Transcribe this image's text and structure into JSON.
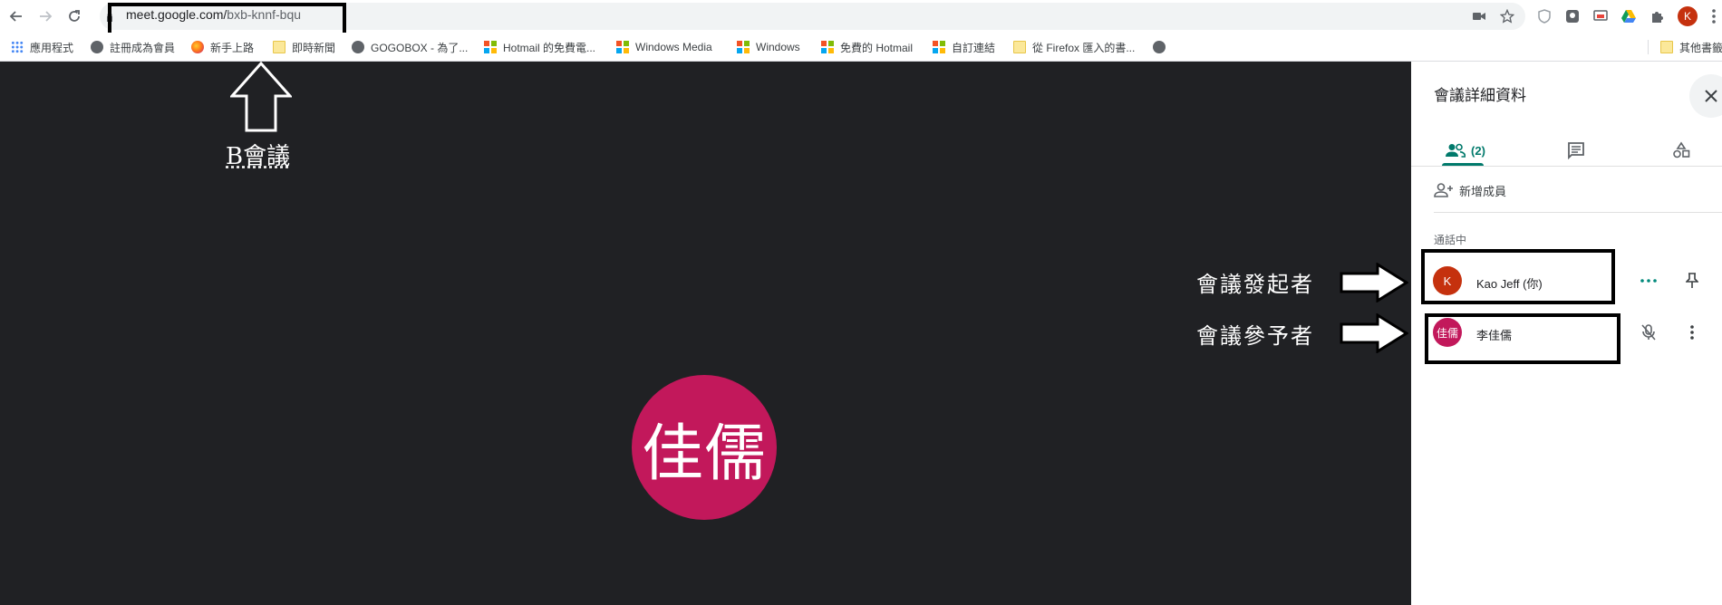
{
  "browser": {
    "url_host": "meet.google.com/",
    "url_path": "bxb-knnf-bqu",
    "profile_initial": "K",
    "icons": [
      "back-icon",
      "forward-icon",
      "reload-icon",
      "camera-icon",
      "star-icon",
      "extension-icon",
      "google-drive-icon",
      "puzzle-icon",
      "menu-icon"
    ]
  },
  "bookmarks": [
    {
      "label": "應用程式",
      "icon": "apps"
    },
    {
      "label": "註冊成為會員",
      "icon": "globe"
    },
    {
      "label": "新手上路",
      "icon": "firefox"
    },
    {
      "label": "即時新聞",
      "icon": "folder"
    },
    {
      "label": "GOGOBOX - 為了...",
      "icon": "globe"
    },
    {
      "label": "Hotmail 的免費電...",
      "icon": "windows"
    },
    {
      "label": "Windows Media",
      "icon": "windows"
    },
    {
      "label": "Windows",
      "icon": "windows"
    },
    {
      "label": "免費的 Hotmail",
      "icon": "windows"
    },
    {
      "label": "自訂連結",
      "icon": "windows"
    },
    {
      "label": "從 Firefox 匯入的書...",
      "icon": "folder"
    },
    {
      "label": "",
      "icon": "globe"
    },
    {
      "label": "其他書籤",
      "icon": "folder"
    }
  ],
  "stage": {
    "presenter_initials": "佳儒",
    "presenter_color": "#c2185b",
    "background": "#202124"
  },
  "annotations": {
    "meeting_b": "B會議",
    "organizer": "會議發起者",
    "participant": "會議參予者"
  },
  "panel": {
    "title": "會議詳細資料",
    "people_count": "(2)",
    "add_member": "新增成員",
    "section": "通話中",
    "accent": "#00796b",
    "participants": [
      {
        "initial": "K",
        "name": "Kao Jeff (你)",
        "color": "#c5310e"
      },
      {
        "initial": "佳儒",
        "name": "李佳儒",
        "color": "#c2185b"
      }
    ]
  }
}
